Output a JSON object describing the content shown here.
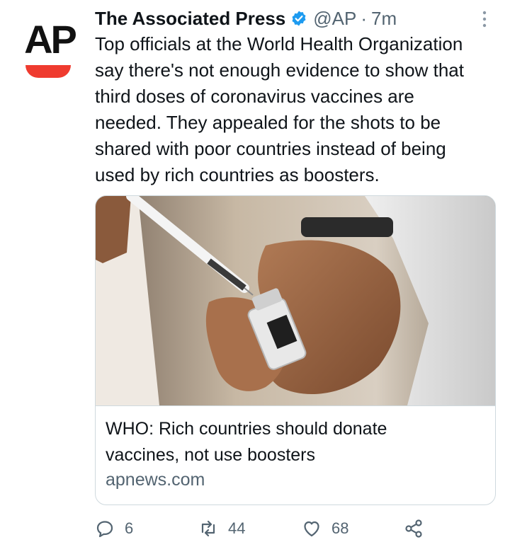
{
  "author": {
    "avatar_text": "AP",
    "display_name": "The Associated Press",
    "handle": "@AP",
    "separator": "·",
    "timestamp": "7m",
    "verified": true
  },
  "tweet": {
    "lines": [
      "Top officials at the World Health Organization",
      "say there's not enough evidence to show that",
      "third doses of coronavirus vaccines are",
      "needed. They appealed for the shots to be",
      "shared with poor countries instead of being",
      "used by rich countries as boosters."
    ]
  },
  "card": {
    "title_lines": [
      "WHO: Rich countries should donate",
      "vaccines, not use boosters"
    ],
    "domain": "apnews.com"
  },
  "actions": {
    "reply_count": "6",
    "retweet_count": "44",
    "like_count": "68"
  },
  "icons": {
    "verified": "verified-badge-icon",
    "more": "more-vertical-icon",
    "reply": "reply-icon",
    "retweet": "retweet-icon",
    "like": "heart-icon",
    "share": "share-icon"
  },
  "colors": {
    "verified": "#1d9bf0",
    "secondary_text": "#536471",
    "brand_red": "#ef3b2f"
  }
}
